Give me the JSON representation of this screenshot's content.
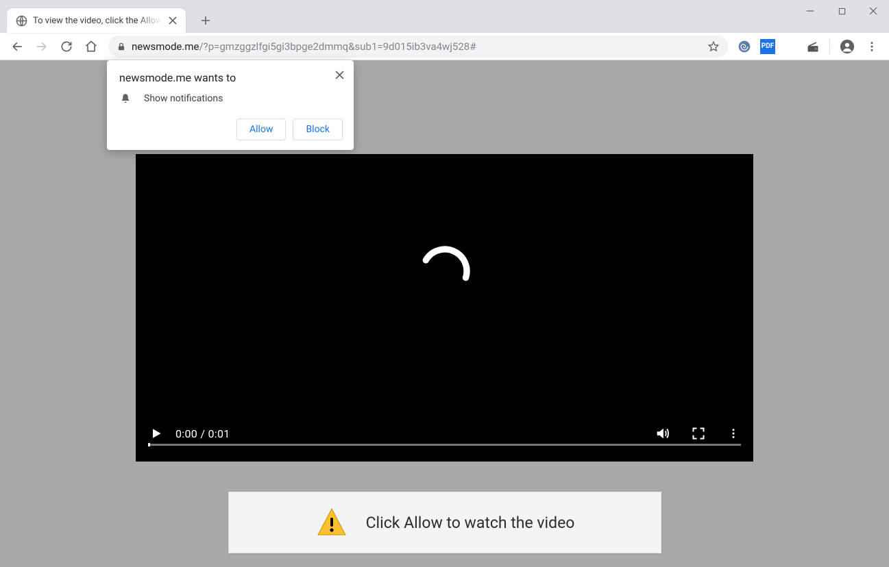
{
  "tab": {
    "title": "To view the video, click the Allow"
  },
  "url": {
    "domain": "newsmode.me",
    "path": "/?p=gmzggzlfgi5gi3bpge2dmmq&sub1=9d015ib3va4wj528#"
  },
  "extensions": {
    "pdf_label": "PDF"
  },
  "prompt": {
    "title": "newsmode.me wants to",
    "permission": "Show notifications",
    "allow": "Allow",
    "block": "Block"
  },
  "video": {
    "current_time": "0:00",
    "duration": "0:01"
  },
  "banner": {
    "message": "Click Allow to watch the video"
  }
}
